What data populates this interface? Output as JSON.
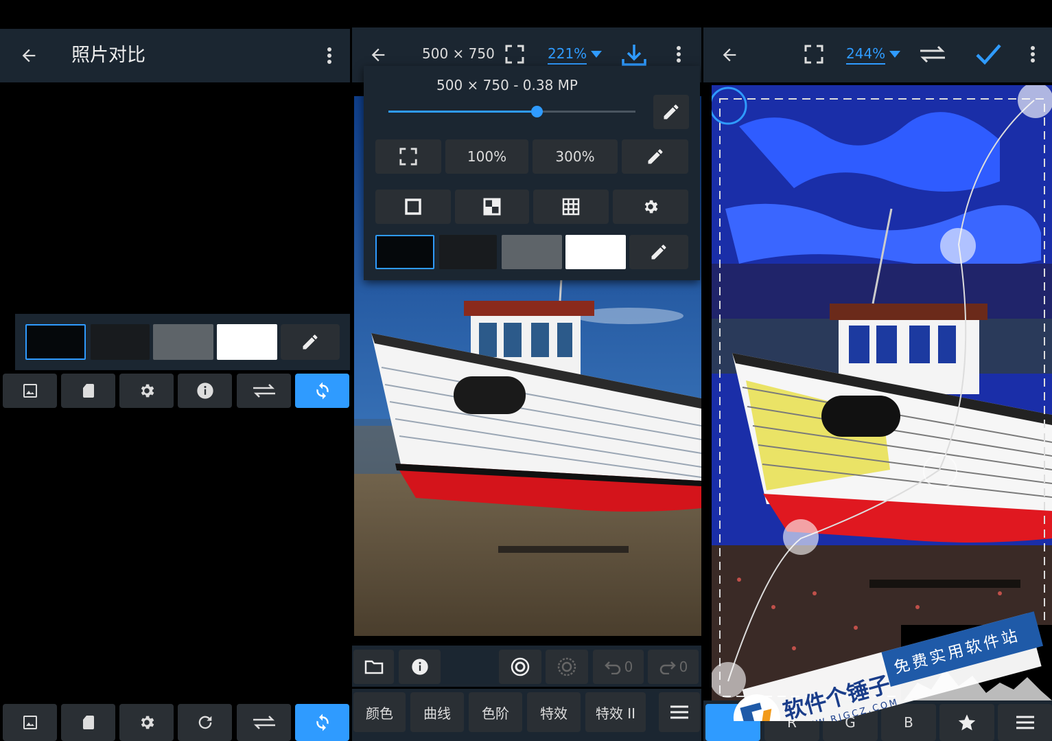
{
  "panel1": {
    "title": "照片对比",
    "swatch_colors": [
      "#05080b",
      "#181b1e",
      "#5e6469",
      "#ffffff"
    ]
  },
  "panel2": {
    "dimensions": "500 × 750",
    "zoom": "221%",
    "popup": {
      "info": "500 × 750 - 0.38 MP",
      "slider_fraction": 0.6,
      "zoom_100": "100%",
      "zoom_300": "300%"
    },
    "undo_count": "0",
    "redo_count": "0",
    "tabs": [
      "颜色",
      "曲线",
      "色阶",
      "特效",
      "特效 II"
    ]
  },
  "panel3": {
    "zoom": "244%",
    "channels": [
      "R",
      "G",
      "B"
    ]
  },
  "watermark": {
    "brand": "软件个锤子",
    "url": "WWW.RJGCZ.COM",
    "slogan": "免费实用软件站"
  },
  "colors": {
    "accent": "#2f9bff",
    "appbar": "#1b2631",
    "button": "#2a2f34"
  }
}
